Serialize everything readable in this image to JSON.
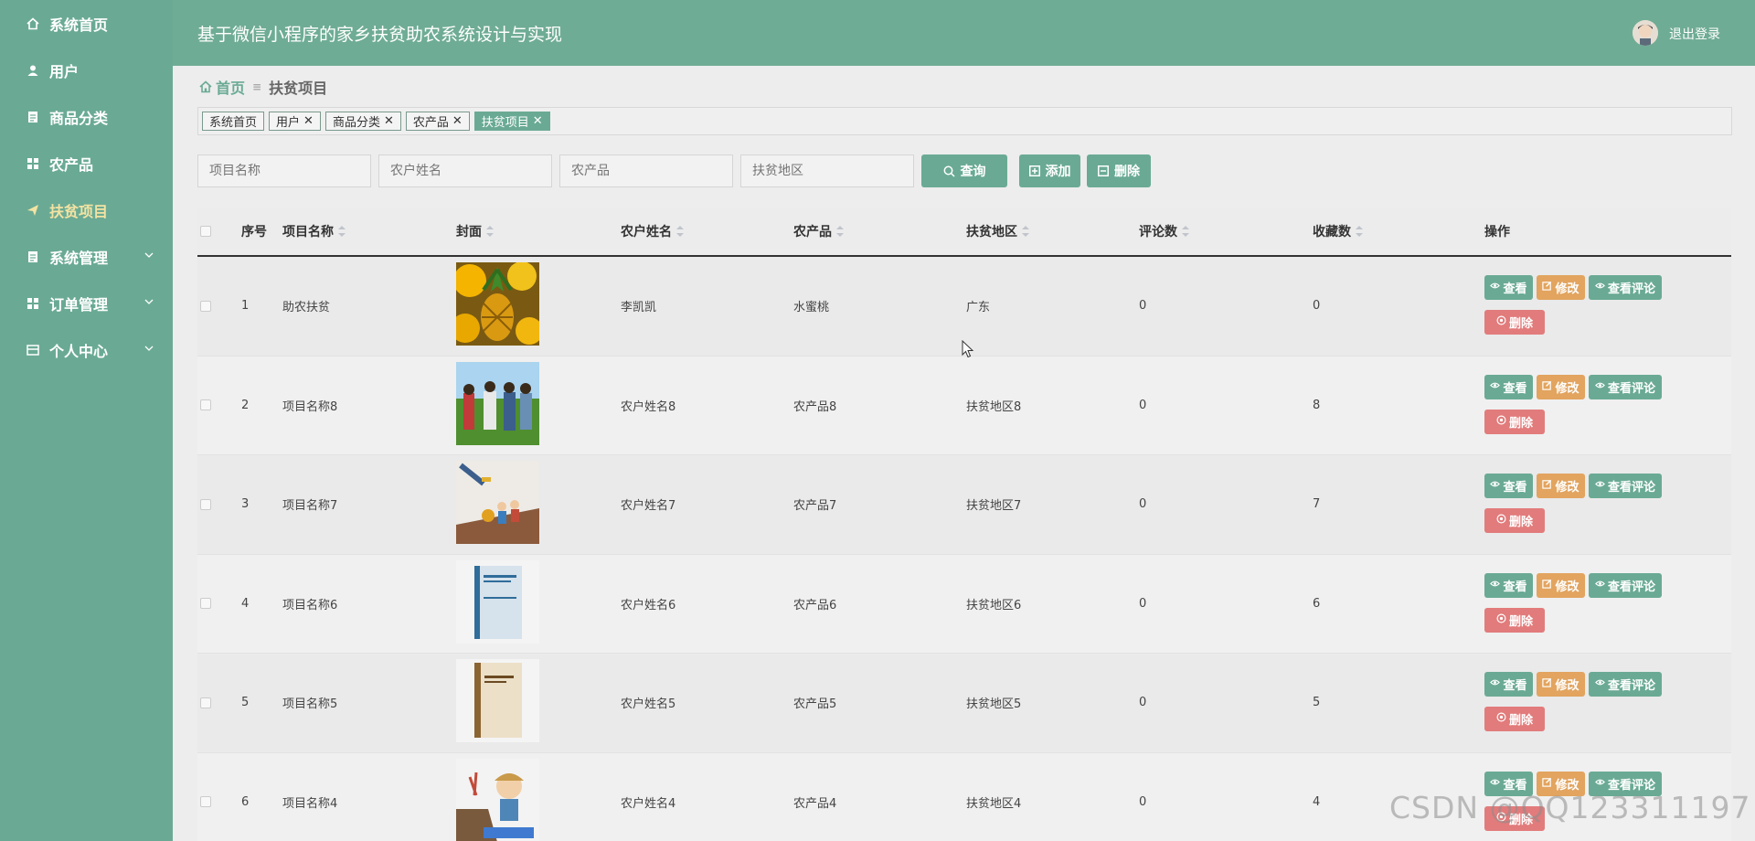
{
  "sidebar": {
    "items": [
      {
        "label": "系统首页",
        "icon": "home-icon",
        "active": false,
        "expandable": false
      },
      {
        "label": "用户",
        "icon": "user-icon",
        "active": false,
        "expandable": false
      },
      {
        "label": "商品分类",
        "icon": "document-icon",
        "active": false,
        "expandable": false
      },
      {
        "label": "农产品",
        "icon": "grid-icon",
        "active": false,
        "expandable": false
      },
      {
        "label": "扶贫项目",
        "icon": "send-icon",
        "active": true,
        "expandable": false
      },
      {
        "label": "系统管理",
        "icon": "document-icon",
        "active": false,
        "expandable": true
      },
      {
        "label": "订单管理",
        "icon": "grid-icon",
        "active": false,
        "expandable": true
      },
      {
        "label": "个人中心",
        "icon": "card-icon",
        "active": false,
        "expandable": true
      }
    ]
  },
  "header": {
    "title": "基于微信小程序的家乡扶贫助农系统设计与实现",
    "logout": "退出登录"
  },
  "breadcrumb": {
    "home": "首页",
    "current": "扶贫项目"
  },
  "tags": [
    {
      "label": "系统首页",
      "closable": false,
      "active": false
    },
    {
      "label": "用户",
      "closable": true,
      "active": false
    },
    {
      "label": "商品分类",
      "closable": true,
      "active": false
    },
    {
      "label": "农产品",
      "closable": true,
      "active": false
    },
    {
      "label": "扶贫项目",
      "closable": true,
      "active": true
    }
  ],
  "search": {
    "placeholders": [
      "项目名称",
      "农户姓名",
      "农产品",
      "扶贫地区"
    ],
    "query_label": "查询",
    "add_label": "添加",
    "delete_label": "删除"
  },
  "table": {
    "columns": [
      "序号",
      "项目名称",
      "封面",
      "农户姓名",
      "农产品",
      "扶贫地区",
      "评论数",
      "收藏数",
      "操作"
    ],
    "rows": [
      {
        "index": "1",
        "name": "助农扶贫",
        "cover": "pineapple-image",
        "farmer": "李凯凯",
        "product": "水蜜桃",
        "region": "广东",
        "comments": "0",
        "favorites": "0"
      },
      {
        "index": "2",
        "name": "项目名称8",
        "cover": "farmers-field-image",
        "farmer": "农户姓名8",
        "product": "农产品8",
        "region": "扶贫地区8",
        "comments": "0",
        "favorites": "8"
      },
      {
        "index": "3",
        "name": "项目名称7",
        "cover": "poverty-illustration-image",
        "farmer": "农户姓名7",
        "product": "农产品7",
        "region": "扶贫地区7",
        "comments": "0",
        "favorites": "7"
      },
      {
        "index": "4",
        "name": "项目名称6",
        "cover": "blue-book-image",
        "farmer": "农户姓名6",
        "product": "农产品6",
        "region": "扶贫地区6",
        "comments": "0",
        "favorites": "6"
      },
      {
        "index": "5",
        "name": "项目名称5",
        "cover": "brown-book-image",
        "farmer": "农户姓名5",
        "product": "农产品5",
        "region": "扶贫地区5",
        "comments": "0",
        "favorites": "5"
      },
      {
        "index": "6",
        "name": "项目名称4",
        "cover": "cartoon-illustration-image",
        "farmer": "农户姓名4",
        "product": "农产品4",
        "region": "扶贫地区4",
        "comments": "0",
        "favorites": "4"
      }
    ],
    "actions": {
      "view": "查看",
      "edit": "修改",
      "comments": "查看评论",
      "delete": "删除"
    }
  },
  "watermark": "CSDN @QQ123311197",
  "colors": {
    "primary": "#6aaa94",
    "edit": "#e2a45f",
    "danger": "#e27b7b",
    "active_menu": "#f3e3a3"
  }
}
